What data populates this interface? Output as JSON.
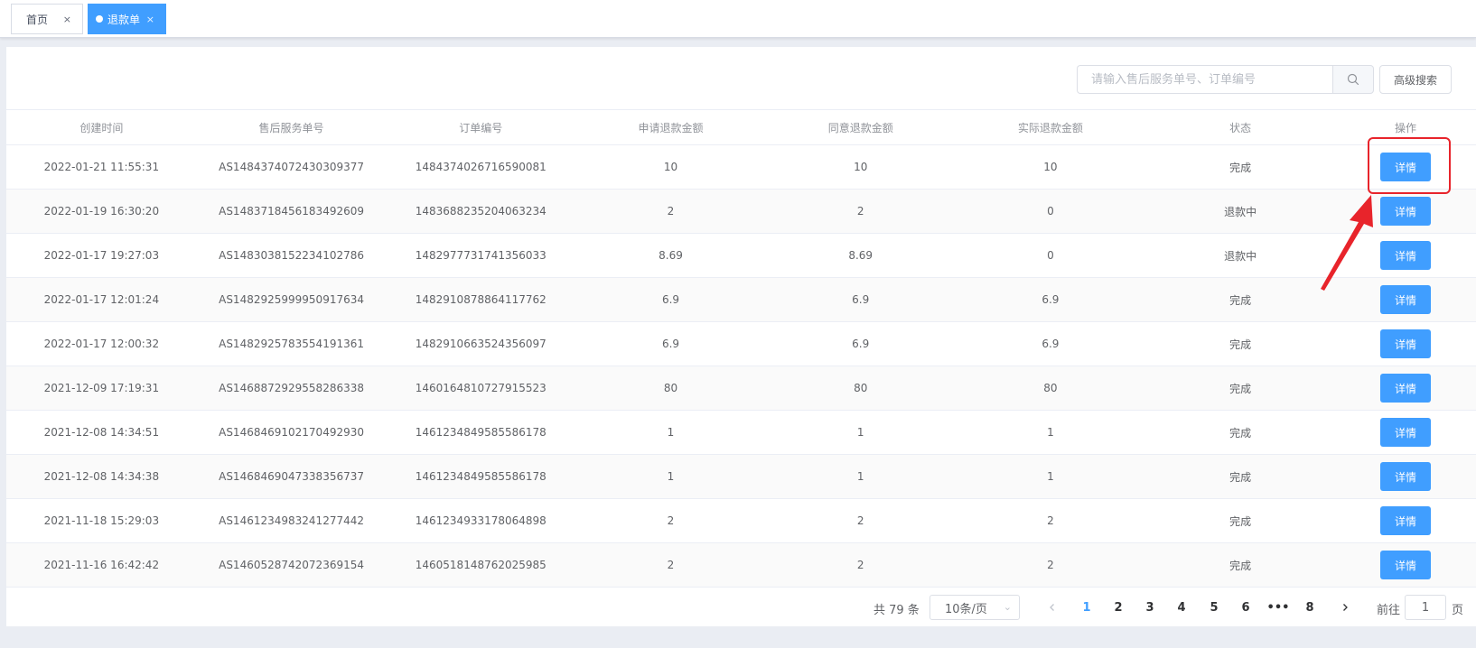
{
  "tabs": [
    {
      "label": "首页",
      "close": "×",
      "active": false
    },
    {
      "label": "退款单",
      "close": "×",
      "active": true
    }
  ],
  "search": {
    "placeholder": "请输入售后服务单号、订单编号",
    "value": ""
  },
  "advanced_search_label": "高级搜索",
  "table": {
    "columns": [
      "创建时间",
      "售后服务单号",
      "订单编号",
      "申请退款金额",
      "同意退款金额",
      "实际退款金额",
      "状态",
      "操作"
    ],
    "action_label": "详情",
    "rows": [
      [
        "2022-01-21 11:55:31",
        "AS1484374072430309377",
        "1484374026716590081",
        "10",
        "10",
        "10",
        "完成"
      ],
      [
        "2022-01-19 16:30:20",
        "AS1483718456183492609",
        "1483688235204063234",
        "2",
        "2",
        "0",
        "退款中"
      ],
      [
        "2022-01-17 19:27:03",
        "AS1483038152234102786",
        "1482977731741356033",
        "8.69",
        "8.69",
        "0",
        "退款中"
      ],
      [
        "2022-01-17 12:01:24",
        "AS1482925999950917634",
        "1482910878864117762",
        "6.9",
        "6.9",
        "6.9",
        "完成"
      ],
      [
        "2022-01-17 12:00:32",
        "AS1482925783554191361",
        "1482910663524356097",
        "6.9",
        "6.9",
        "6.9",
        "完成"
      ],
      [
        "2021-12-09 17:19:31",
        "AS1468872929558286338",
        "1460164810727915523",
        "80",
        "80",
        "80",
        "完成"
      ],
      [
        "2021-12-08 14:34:51",
        "AS1468469102170492930",
        "1461234849585586178",
        "1",
        "1",
        "1",
        "完成"
      ],
      [
        "2021-12-08 14:34:38",
        "AS1468469047338356737",
        "1461234849585586178",
        "1",
        "1",
        "1",
        "完成"
      ],
      [
        "2021-11-18 15:29:03",
        "AS1461234983241277442",
        "1461234933178064898",
        "2",
        "2",
        "2",
        "完成"
      ],
      [
        "2021-11-16 16:42:42",
        "AS1460528742072369154",
        "1460518148762025985",
        "2",
        "2",
        "2",
        "完成"
      ]
    ]
  },
  "pagination": {
    "total_text": "共 79 条",
    "page_size": "10条/页",
    "pages": [
      "1",
      "2",
      "3",
      "4",
      "5",
      "6",
      "•••",
      "8"
    ],
    "current": "1",
    "goto_label": "前往",
    "goto_value": "1",
    "goto_suffix": "页"
  },
  "colors": {
    "accent": "#409eff",
    "annotation": "#e8242b"
  }
}
